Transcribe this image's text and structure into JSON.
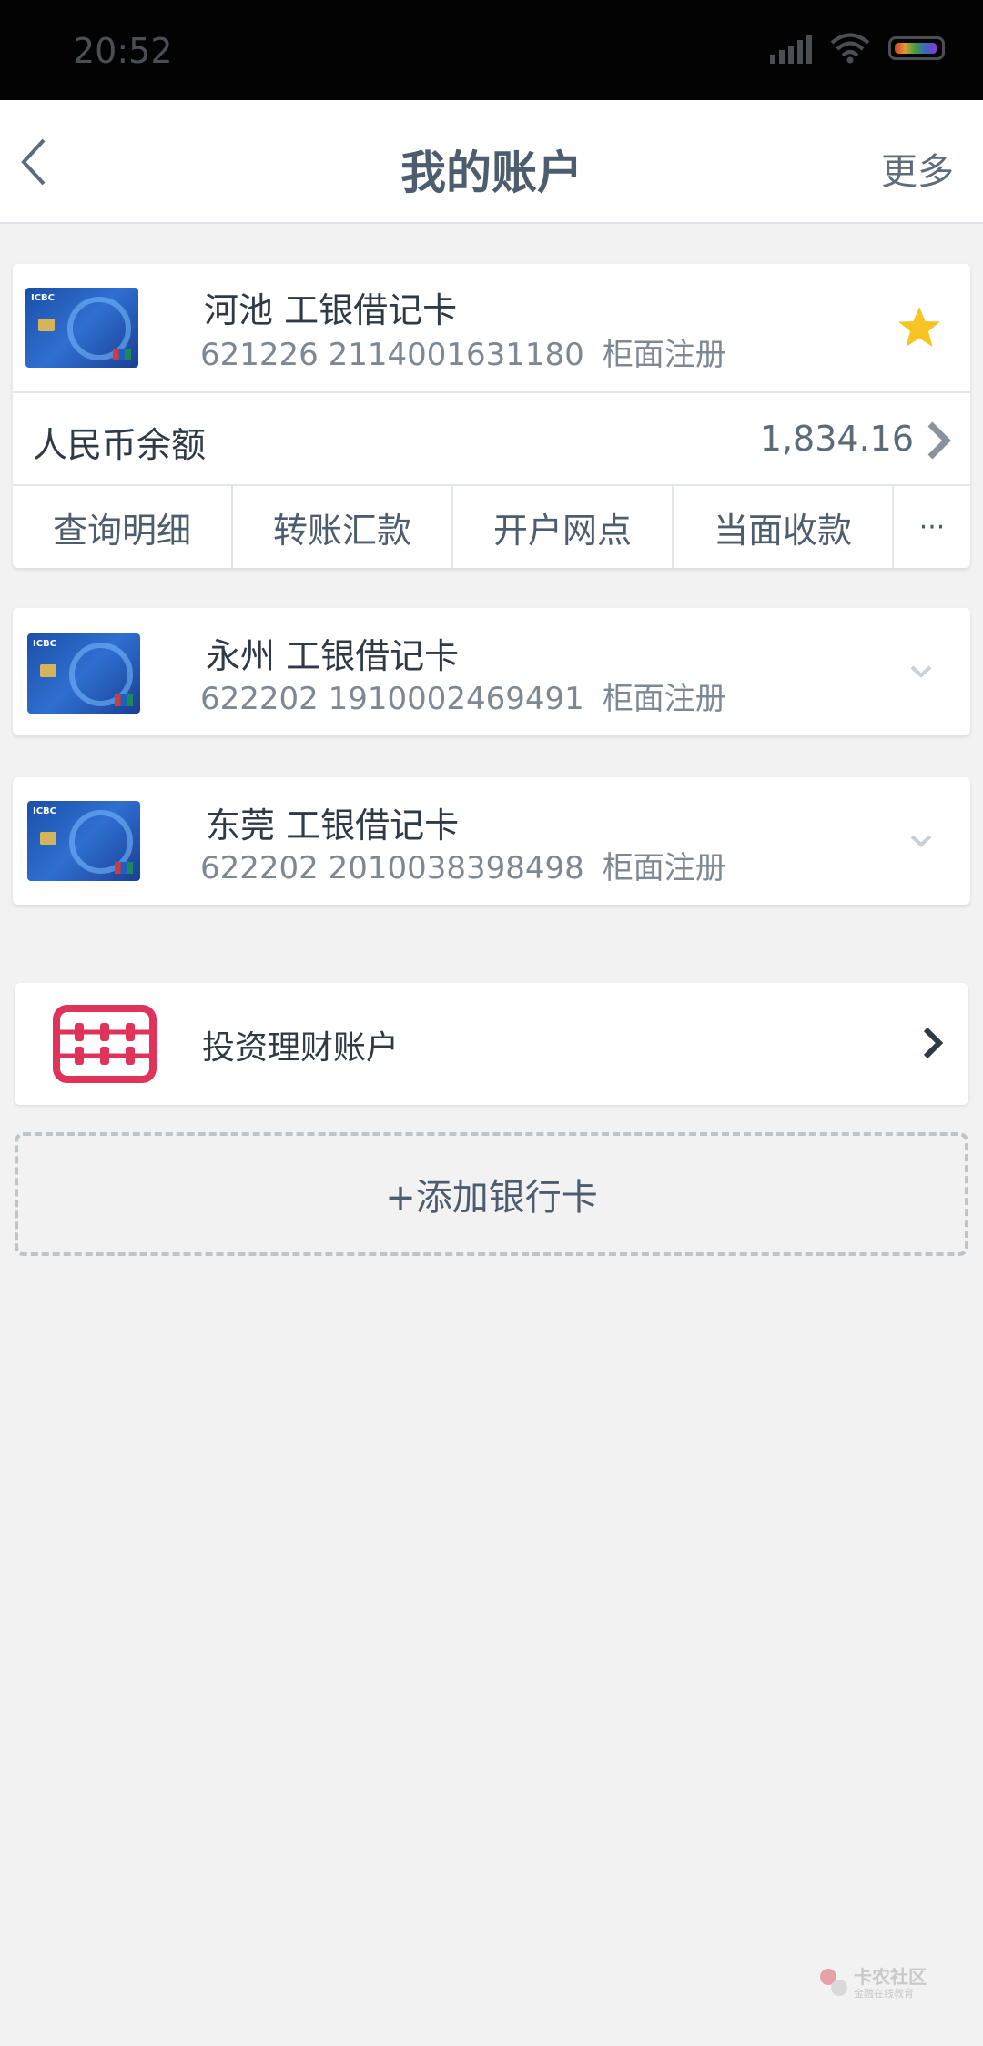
{
  "status_bar": {
    "time": "20:52"
  },
  "nav": {
    "title": "我的账户",
    "more_label": "更多"
  },
  "primary_card": {
    "name": "河池 工银借记卡",
    "number": "621226 2114001631180",
    "registration": "柜面注册",
    "balance_label": "人民币余额",
    "balance": "1,834.16",
    "actions": [
      "查询明细",
      "转账汇款",
      "开户网点",
      "当面收款"
    ],
    "more_actions": "···"
  },
  "cards": [
    {
      "name": "永州 工银借记卡",
      "number": "622202 1910002469491",
      "registration": "柜面注册"
    },
    {
      "name": "东莞 工银借记卡",
      "number": "622202 2010038398498",
      "registration": "柜面注册"
    }
  ],
  "invest": {
    "label": "投资理财账户",
    "icon": "abacus-icon"
  },
  "add_card": {
    "label": "+添加银行卡"
  },
  "watermark": {
    "title": "卡农社区",
    "subtitle": "金融在线教育"
  },
  "colors": {
    "star": "#f7c325",
    "abacus": "#e0335a",
    "nav_title": "#4d5d6e",
    "background": "#f2f2f2"
  }
}
